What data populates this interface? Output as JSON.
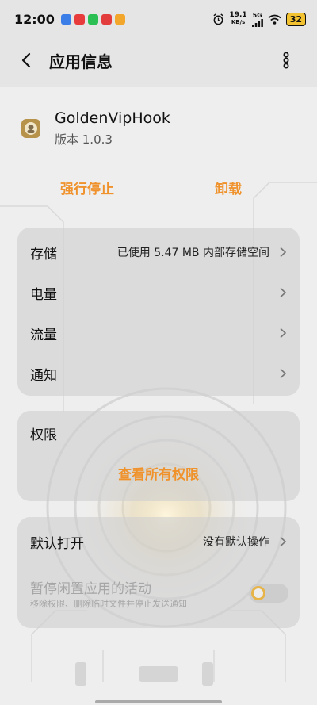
{
  "status_bar": {
    "time": "12:00",
    "network_speed": "19.1",
    "network_unit": "KB/s",
    "network_type": "5G",
    "battery": "32"
  },
  "header": {
    "title": "应用信息"
  },
  "app": {
    "name": "GoldenVipHook",
    "version": "版本 1.0.3"
  },
  "actions": {
    "force_stop": "强行停止",
    "uninstall": "卸载"
  },
  "settings_card": {
    "rows": [
      {
        "label": "存储",
        "value": "已使用 5.47 MB 内部存储空间"
      },
      {
        "label": "电量",
        "value": ""
      },
      {
        "label": "流量",
        "value": ""
      },
      {
        "label": "通知",
        "value": ""
      }
    ]
  },
  "permissions_card": {
    "title": "权限",
    "link": "查看所有权限"
  },
  "defaults_card": {
    "default_open_label": "默认打开",
    "default_open_value": "没有默认操作",
    "pause_title": "暂停闲置应用的活动",
    "pause_subtitle": "移除权限、删除临时文件并停止发送通知",
    "pause_enabled": false
  },
  "colors": {
    "accent": "#f0922b",
    "background": "#eeeeee",
    "card": "#cecece",
    "disabled_text": "#a6a6a6"
  }
}
